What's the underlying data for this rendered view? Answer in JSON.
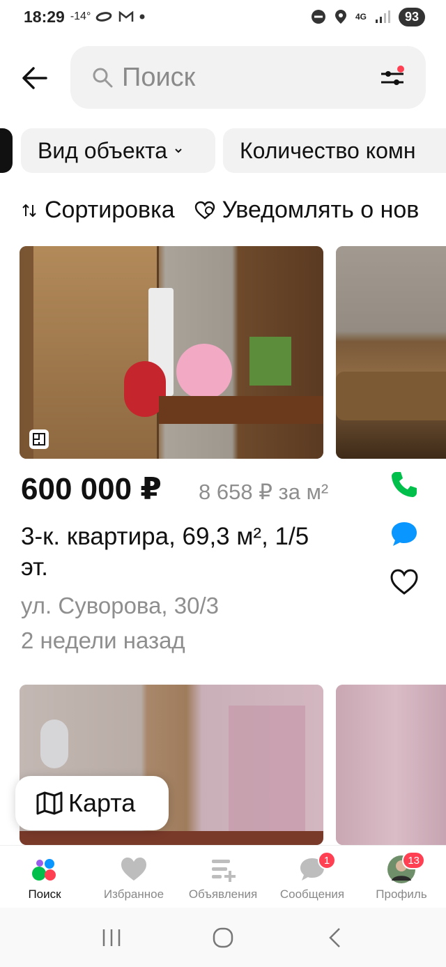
{
  "status_bar": {
    "time": "18:29",
    "temp": "-14°",
    "battery": "93",
    "network": "4G"
  },
  "search": {
    "placeholder": "Поиск"
  },
  "filters": {
    "chips": [
      "Вид объекта",
      "Количество комн"
    ]
  },
  "sort_row": {
    "sort_label": "Сортировка",
    "notify_label": "Уведомлять о нов"
  },
  "listing": {
    "price": "600 000 ₽",
    "price_per_m2": "8 658 ₽ за м²",
    "title": "3-к. квартира, 69,3 м², 1/5 эт.",
    "address": "ул. Суворова, 30/3",
    "date": "2 недели назад"
  },
  "map_button": {
    "label": "Карта"
  },
  "bottom_nav": {
    "items": [
      {
        "label": "Поиск",
        "icon": "search-tab-icon"
      },
      {
        "label": "Избранное",
        "icon": "heart-icon"
      },
      {
        "label": "Объявления",
        "icon": "listings-add-icon"
      },
      {
        "label": "Сообщения",
        "icon": "chat-icon",
        "badge": "1"
      },
      {
        "label": "Профиль",
        "icon": "avatar",
        "badge": "13"
      }
    ]
  },
  "colors": {
    "accent_green": "#00c04b",
    "accent_blue": "#0a96ff",
    "badge_red": "#ff4053"
  }
}
